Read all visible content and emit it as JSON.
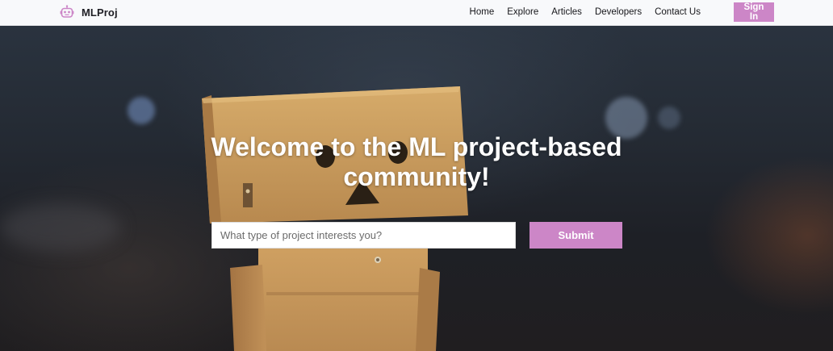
{
  "navbar": {
    "brand_icon": "robot-icon",
    "brand_name": "MLProj",
    "links": [
      "Home",
      "Explore",
      "Articles",
      "Developers",
      "Contact Us"
    ],
    "sign_in_label": "Sign In"
  },
  "hero": {
    "title": "Welcome to the ML project-based community!",
    "search_placeholder": "What type of project interests you?",
    "submit_label": "Submit"
  },
  "colors": {
    "accent": "#cc86c7",
    "navbar_bg": "#f8f9fb",
    "hero_text": "#ffffff"
  }
}
